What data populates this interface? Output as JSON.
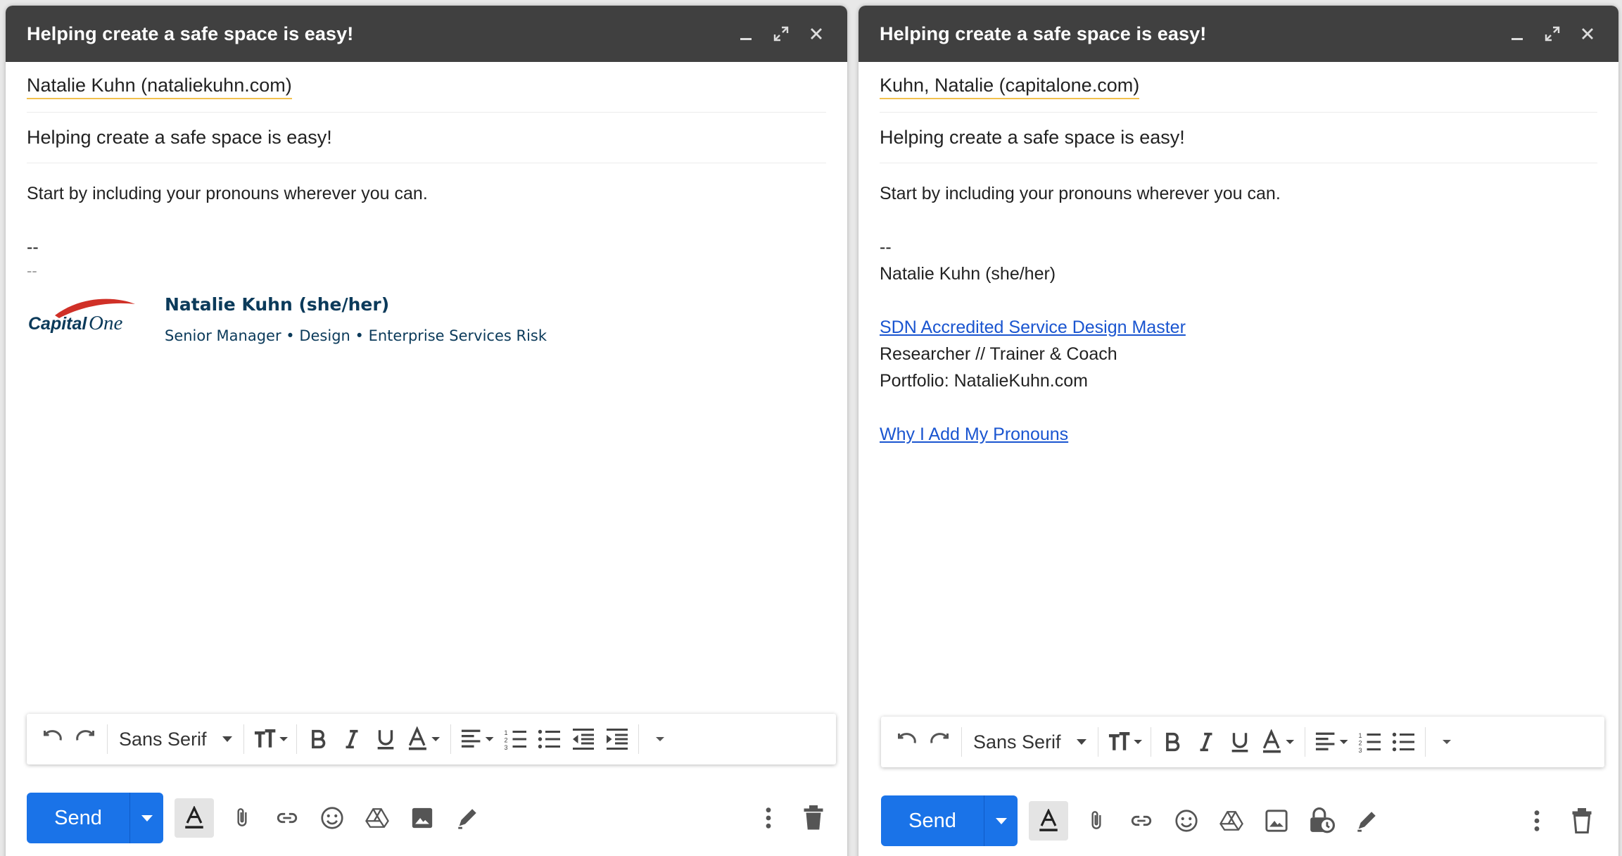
{
  "left": {
    "title": "Helping create a safe space is easy!",
    "recipient": "Natalie Kuhn (nataliekuhn.com)",
    "subject": "Helping create a safe space is easy!",
    "body_line": "Start by including your pronouns wherever you can.",
    "sig_dash1": "--",
    "sig_dash2": "--",
    "logo_text_capital": "Capital",
    "logo_text_one": "One",
    "sig_name": "Natalie Kuhn (she/her)",
    "sig_title": "Senior Manager • Design • Enterprise Services Risk",
    "font": "Sans Serif",
    "send": "Send"
  },
  "right": {
    "title": "Helping create a safe space is easy!",
    "recipient": "Kuhn, Natalie (capitalone.com)",
    "subject": "Helping create a safe space is easy!",
    "body_line": "Start by including your pronouns wherever you can.",
    "sig_dash": "--",
    "sig_name": "Natalie Kuhn (she/her)",
    "sig_link1": "SDN Accredited Service Design Master",
    "sig_line2": "Researcher // Trainer & Coach",
    "sig_line3": "Portfolio: NatalieKuhn.com",
    "sig_link2": "Why I Add My Pronouns",
    "font": "Sans Serif",
    "send": "Send"
  },
  "colors": {
    "titlebar": "#404040",
    "send": "#1a73e8",
    "link": "#1a55d0",
    "capital_one_blue": "#0b3a5a",
    "capital_one_red": "#d03027",
    "recipient_underline": "#f2c14e"
  },
  "icons": [
    "minimize-icon",
    "expand-icon",
    "close-icon",
    "undo-icon",
    "redo-icon",
    "text-size-icon",
    "bold-icon",
    "italic-icon",
    "underline-icon",
    "text-color-icon",
    "align-icon",
    "numbered-list-icon",
    "bulleted-list-icon",
    "indent-less-icon",
    "indent-more-icon",
    "more-formatting-icon",
    "formatting-options-icon",
    "attach-icon",
    "link-icon",
    "emoji-icon",
    "drive-icon",
    "photo-icon",
    "confidential-icon",
    "signature-icon",
    "more-options-icon",
    "trash-icon"
  ]
}
